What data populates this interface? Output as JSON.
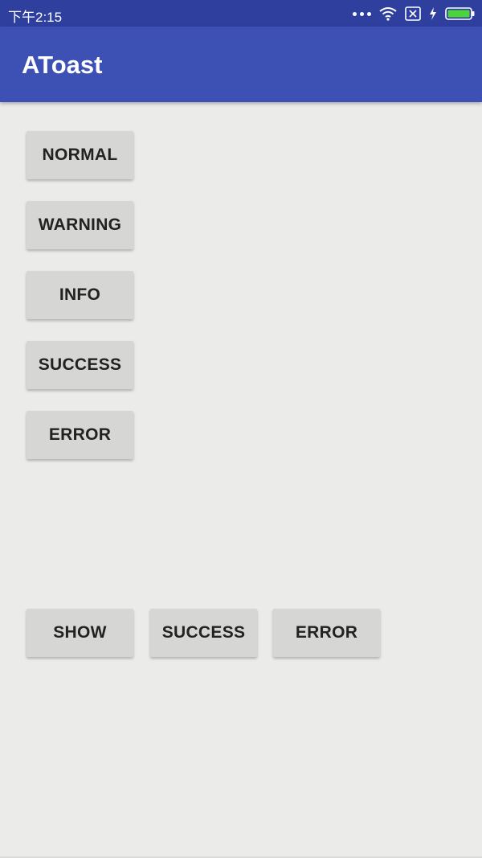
{
  "status_bar": {
    "time": "下午2:15",
    "icons": [
      "more-dots-icon",
      "wifi-icon",
      "sim-off-icon",
      "charging-icon",
      "battery-icon"
    ],
    "battery_color": "#4cd43c"
  },
  "app_bar": {
    "title": "AToast",
    "color": "#3d51b5"
  },
  "buttons_column": [
    "NORMAL",
    "WARNING",
    "INFO",
    "SUCCESS",
    "ERROR"
  ],
  "buttons_row": [
    "SHOW",
    "SUCCESS",
    "ERROR"
  ]
}
